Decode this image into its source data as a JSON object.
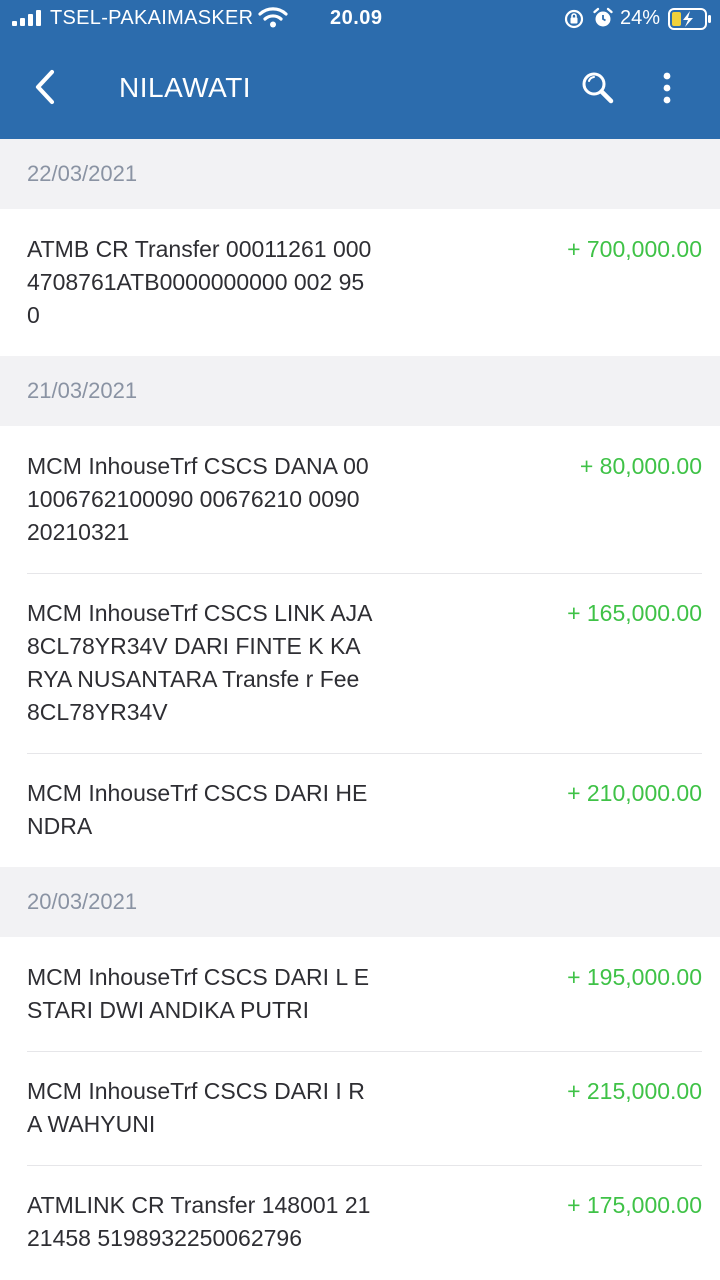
{
  "status_bar": {
    "carrier": "TSEL-PAKAIMASKER",
    "time": "20.09",
    "battery": "24%"
  },
  "app_bar": {
    "title": "NILAWATI",
    "icons": [
      "back-arrow-icon",
      "search-icon",
      "more-vertical-icon"
    ]
  },
  "colors": {
    "header": "#2c6cad",
    "amount_positive": "#3fc247",
    "date_header_bg": "#f2f2f4"
  },
  "groups": [
    {
      "date": "22/03/2021",
      "transactions": [
        {
          "description": "ATMB CR Transfer 00011261 0004708761ATB0000000000 002 950",
          "amount": "+ 700,000.00"
        }
      ]
    },
    {
      "date": "21/03/2021",
      "transactions": [
        {
          "description": "MCM InhouseTrf CSCS DANA 001006762100090 00676210 0090 20210321",
          "amount": "+ 80,000.00"
        },
        {
          "description": "MCM InhouseTrf CSCS LINK AJA 8CL78YR34V DARI FINTE K KARYA NUSANTARA Transfe r Fee 8CL78YR34V",
          "amount": "+ 165,000.00"
        },
        {
          "description": "MCM InhouseTrf CSCS DARI HENDRA",
          "amount": "+ 210,000.00"
        }
      ]
    },
    {
      "date": "20/03/2021",
      "transactions": [
        {
          "description": "MCM InhouseTrf CSCS DARI L ESTARI DWI ANDIKA PUTRI",
          "amount": "+ 195,000.00"
        },
        {
          "description": "MCM InhouseTrf CSCS DARI I RA WAHYUNI",
          "amount": "+ 215,000.00"
        },
        {
          "description": "ATMLINK CR Transfer 148001 2121458 5198932250062796",
          "amount": "+ 175,000.00"
        }
      ]
    }
  ]
}
